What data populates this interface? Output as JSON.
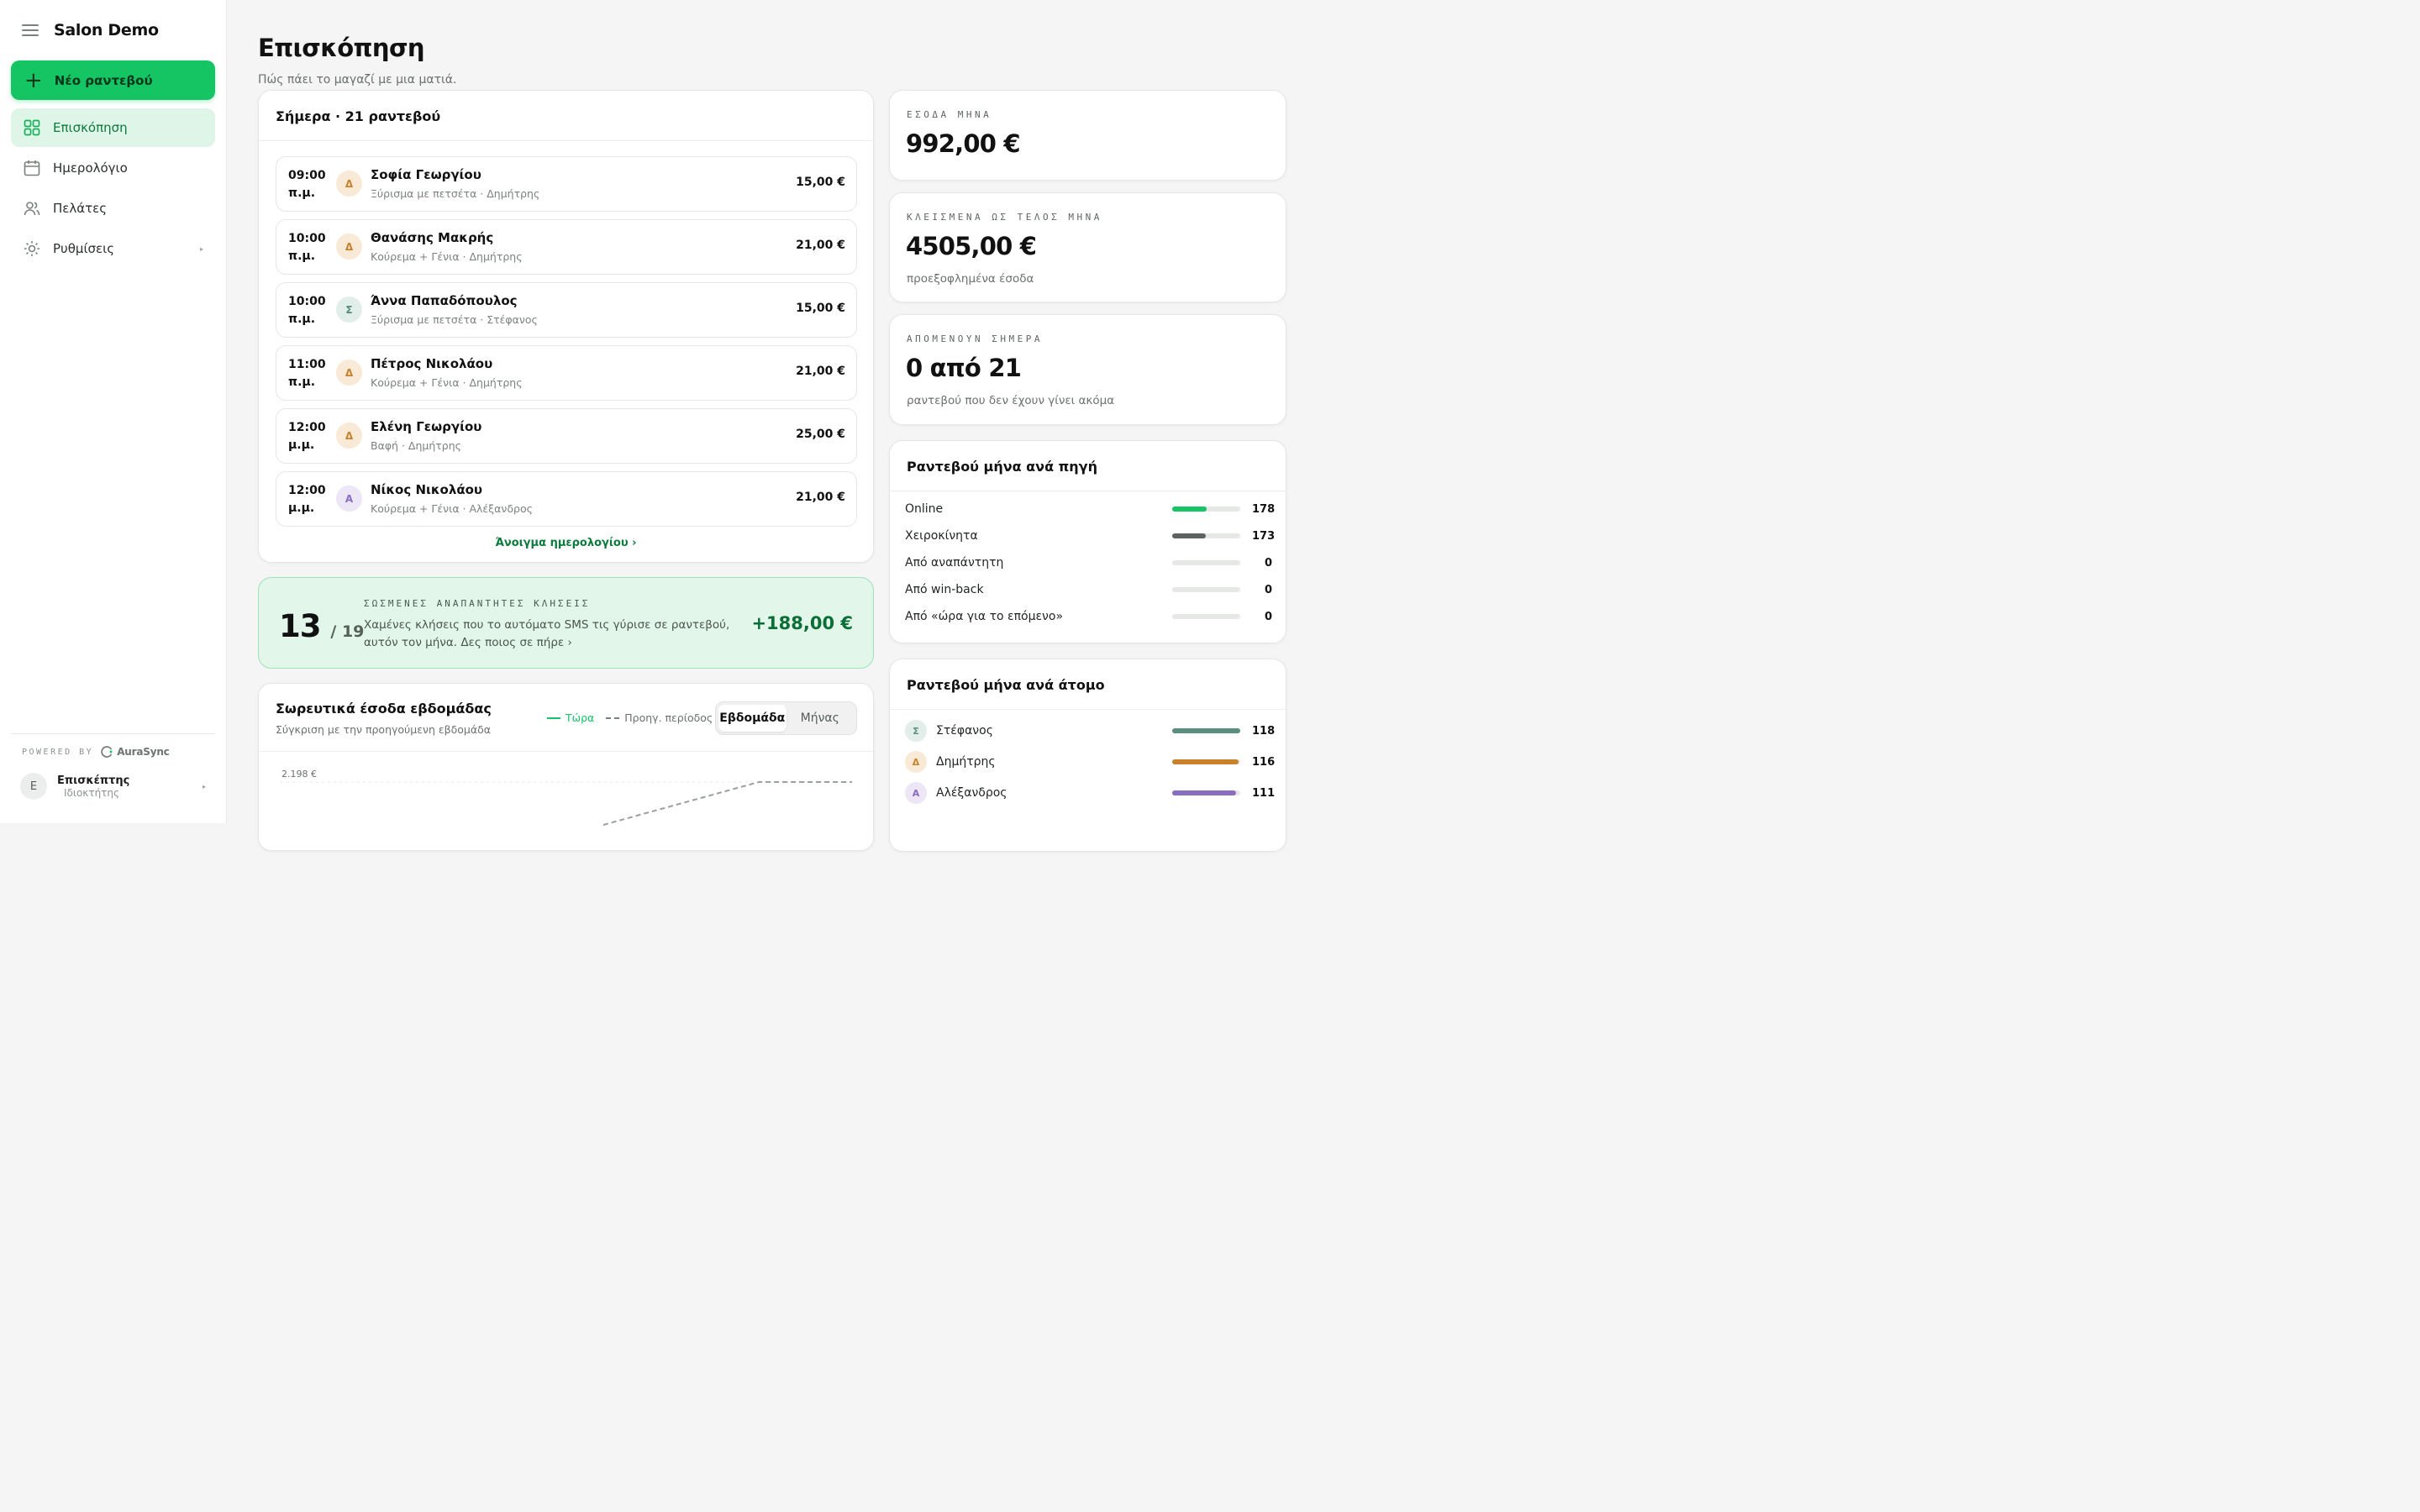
{
  "app": {
    "brand": "Salon Demo"
  },
  "sidebar": {
    "new_button": "Νέο ραντεβού",
    "items": [
      {
        "label": "Επισκόπηση",
        "icon": "grid-icon",
        "active": true
      },
      {
        "label": "Ημερολόγιο",
        "icon": "calendar-icon",
        "active": false
      },
      {
        "label": "Πελάτες",
        "icon": "users-icon",
        "active": false
      },
      {
        "label": "Ρυθμίσεις",
        "icon": "sun-gear-icon",
        "active": false
      }
    ],
    "powered_by": "POWERED BY",
    "powered_brand": "AuraSync",
    "user": {
      "initial": "Ε",
      "name": "Επισκέπτης",
      "role": "Ιδιοκτήτης"
    }
  },
  "header": {
    "title": "Επισκόπηση",
    "subtitle": "Πώς πάει το μαγαζί με μια ματιά."
  },
  "today": {
    "title": "Σήμερα · 21 ραντεβού",
    "appointments": [
      {
        "time": "09:00",
        "period": "π.μ.",
        "initial": "Δ",
        "name": "Σοφία Γεωργίου",
        "service": "Ξύρισμα με πετσέτα · Δημήτρης",
        "price": "15,00 €",
        "color": "#c8822c",
        "bg": "#f8ead6"
      },
      {
        "time": "10:00",
        "period": "π.μ.",
        "initial": "Δ",
        "name": "Θανάσης Μακρής",
        "service": "Κούρεμα + Γένια · Δημήτρης",
        "price": "21,00 €",
        "color": "#c8822c",
        "bg": "#f8ead6"
      },
      {
        "time": "10:00",
        "period": "π.μ.",
        "initial": "Σ",
        "name": "Άννα Παπαδόπουλος",
        "service": "Ξύρισμα με πετσέτα · Στέφανος",
        "price": "15,00 €",
        "color": "#4f8a78",
        "bg": "#e1eeea"
      },
      {
        "time": "11:00",
        "period": "π.μ.",
        "initial": "Δ",
        "name": "Πέτρος Νικολάου",
        "service": "Κούρεμα + Γένια · Δημήτρης",
        "price": "21,00 €",
        "color": "#c8822c",
        "bg": "#f8ead6"
      },
      {
        "time": "12:00",
        "period": "μ.μ.",
        "initial": "Δ",
        "name": "Ελένη Γεωργίου",
        "service": "Βαφή · Δημήτρης",
        "price": "25,00 €",
        "color": "#c8822c",
        "bg": "#f8ead6"
      },
      {
        "time": "12:00",
        "period": "μ.μ.",
        "initial": "Α",
        "name": "Νίκος Νικολάου",
        "service": "Κούρεμα + Γένια · Αλέξανδρος",
        "price": "21,00 €",
        "color": "#8a6cc0",
        "bg": "#ece6f6"
      }
    ],
    "open_calendar": "Άνοιγμα ημερολογίου ›"
  },
  "saved_calls": {
    "count": "13",
    "total": "/ 19",
    "label": "ΣΩΣΜΕΝΕΣ ΑΝΑΠΑΝΤΗΤΕΣ ΚΛΗΣΕΙΣ",
    "description": "Χαμένες κλήσεις που το αυτόματο SMS τις γύρισε σε ραντεβού, αυτόν τον μήνα. Δες ποιος σε πήρε ›",
    "amount": "+188,00 €"
  },
  "weekly": {
    "title": "Σωρευτικά έσοδα εβδομάδας",
    "subtitle": "Σύγκριση με την προηγούμενη εβδομάδα",
    "legend_now": "Τώρα",
    "legend_prev": "Προηγ. περίοδος",
    "seg_week": "Εβδομάδα",
    "seg_month": "Μήνας",
    "y_tick": "2.198 €"
  },
  "stats": [
    {
      "label": "ΕΣΟΔΑ ΜΗΝΑ",
      "value": "992,00 €",
      "note": ""
    },
    {
      "label": "ΚΛΕΙΣΜΕΝΑ ΩΣ ΤΕΛΟΣ ΜΗΝΑ",
      "value": "4505,00 €",
      "note": "προεξοφλημένα έσοδα"
    },
    {
      "label": "ΑΠΟΜΕΝΟΥΝ ΣΗΜΕΡΑ",
      "value": "0 από 21",
      "note": "ραντεβού που δεν έχουν γίνει ακόμα"
    }
  ],
  "by_source": {
    "title": "Ραντεβού μήνα ανά πηγή",
    "rows": [
      {
        "label": "Online",
        "value": "178",
        "fraction": 0.51,
        "color": "#15c462"
      },
      {
        "label": "Χειροκίνητα",
        "value": "173",
        "fraction": 0.49,
        "color": "#5c6361"
      },
      {
        "label": "Από αναπάντητη",
        "value": "0",
        "fraction": 0,
        "color": "#15c462"
      },
      {
        "label": "Από win-back",
        "value": "0",
        "fraction": 0,
        "color": "#15c462"
      },
      {
        "label": "Από «ώρα για το επόμενο»",
        "value": "0",
        "fraction": 0,
        "color": "#15c462"
      }
    ]
  },
  "by_person": {
    "title": "Ραντεβού μήνα ανά άτομο",
    "rows": [
      {
        "initial": "Σ",
        "label": "Στέφανος",
        "value": "118",
        "fraction": 1.0,
        "color": "#5a8f80",
        "bg": "#e1eeea"
      },
      {
        "initial": "Δ",
        "label": "Δημήτρης",
        "value": "116",
        "fraction": 0.98,
        "color": "#c8822c",
        "bg": "#f8ead6"
      },
      {
        "initial": "Α",
        "label": "Αλέξανδρος",
        "value": "111",
        "fraction": 0.94,
        "color": "#8a6cc0",
        "bg": "#ece6f6"
      }
    ]
  }
}
